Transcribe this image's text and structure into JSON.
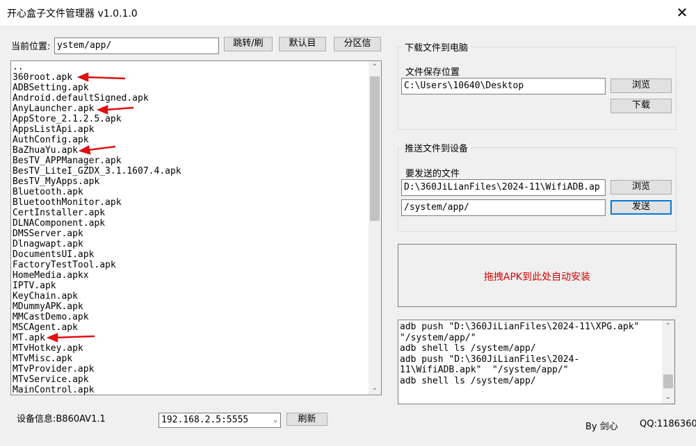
{
  "window": {
    "title": "开心盒子文件管理器 v1.0.1.0",
    "close_glyph": "✕"
  },
  "location": {
    "label": "当前位置:",
    "value": "ystem/app/"
  },
  "buttons": {
    "jump": "跳转/刷",
    "default_dir": "默认目",
    "partition": "分区信",
    "browse1": "浏览",
    "download": "下载",
    "browse2": "浏览",
    "send": "发送",
    "refresh": "刷新"
  },
  "file_list": {
    "items": [
      "..",
      "360root.apk",
      "ADBSetting.apk",
      "Android.defaultSigned.apk",
      "AnyLauncher.apk",
      "AppStore_2.1.2.5.apk",
      "AppsListApi.apk",
      "AuthConfig.apk",
      "BaZhuaYu.apk",
      "BesTV_APPManager.apk",
      "BesTV_LiteI_GZDX_3.1.1607.4.apk",
      "BesTV_MyApps.apk",
      "Bluetooth.apk",
      "BluetoothMonitor.apk",
      "CertInstaller.apk",
      "DLNAComponent.apk",
      "DMSServer.apk",
      "Dlnagwapt.apk",
      "DocumentsUI.apk",
      "FactoryTestTool.apk",
      "HomeMedia.apkx",
      "IPTV.apk",
      "KeyChain.apk",
      "MDummyAPK.apk",
      "MMCastDemo.apk",
      "MSCAgent.apk",
      "MT.apk",
      "MTvHotkey.apk",
      "MTvMisc.apk",
      "MTvProvider.apk",
      "MTvService.apk",
      "MainControl.apk"
    ],
    "scroll_up_glyph": "⌃",
    "scroll_down_glyph": "⌄"
  },
  "download_group": {
    "title": "下载文件到电脑",
    "save_label": "文件保存位置",
    "save_path": "C:\\Users\\10640\\Desktop"
  },
  "push_group": {
    "title": "推送文件到设备",
    "file_label": "要发送的文件",
    "file_path": "D:\\360JiLianFiles\\2024-11\\WifiADB.ap",
    "target_path": "/system/app/"
  },
  "drop_zone": {
    "text": "拖拽APK到此处自动安装"
  },
  "log": {
    "lines": [
      "adb push \"D:\\360JiLianFiles\\2024-11\\XPG.apk\" \"/system/app/\"",
      "adb shell ls /system/app/",
      "adb push \"D:\\360JiLianFiles\\2024-11\\WifiADB.apk\"  \"/system/app/\"",
      "adb shell ls /system/app/"
    ],
    "scroll_up_glyph": "⌃",
    "scroll_down_glyph": "⌄"
  },
  "device": {
    "info_label": "设备信息:B860AV1.1",
    "address": "192.168.2.5:5555",
    "dropdown_glyph": "⌄"
  },
  "footer": {
    "author": "By 剑心",
    "qq": "QQ:1186360"
  },
  "colors": {
    "annotation_arrow": "#e01010",
    "drop_text": "#d80000",
    "focus_border": "#0078d7"
  }
}
